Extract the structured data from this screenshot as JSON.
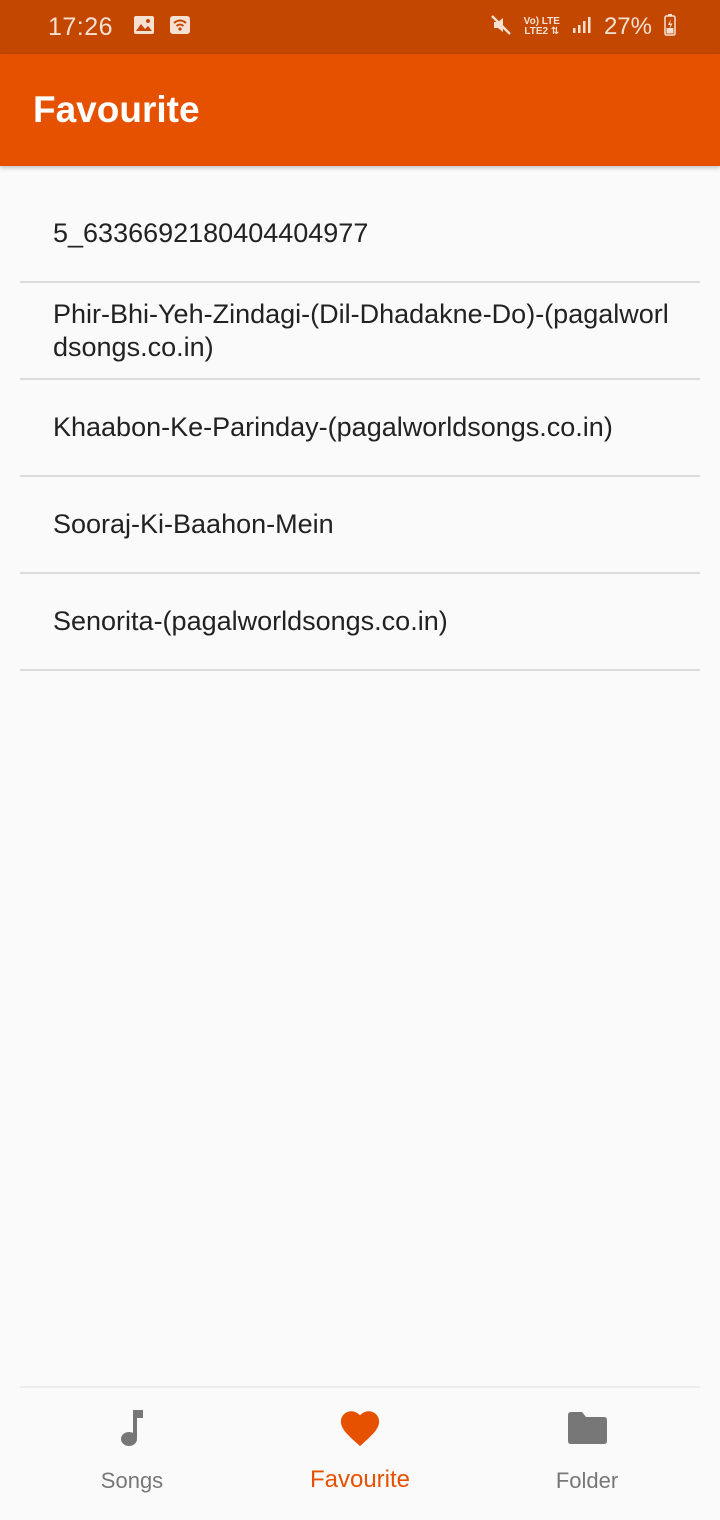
{
  "status_bar": {
    "time": "17:26",
    "net_top": "Vo) LTE",
    "net_bottom": "LTE2 ⇅",
    "battery": "27%"
  },
  "app_bar": {
    "title": "Favourite"
  },
  "songs": [
    "5_6336692180404404977",
    "Phir-Bhi-Yeh-Zindagi-(Dil-Dhadakne-Do)-(pagalworldsongs.co.in)",
    "Khaabon-Ke-Parinday-(pagalworldsongs.co.in)",
    "Sooraj-Ki-Baahon-Mein",
    "Senorita-(pagalworldsongs.co.in)"
  ],
  "bottom_nav": {
    "items": [
      {
        "label": "Songs",
        "icon": "music-note-icon"
      },
      {
        "label": "Favourite",
        "icon": "heart-icon",
        "active": true
      },
      {
        "label": "Folder",
        "icon": "folder-icon"
      }
    ]
  },
  "colors": {
    "status_bar": "#c44700",
    "app_bar": "#e65100",
    "accent": "#e65100",
    "inactive": "#777777"
  }
}
